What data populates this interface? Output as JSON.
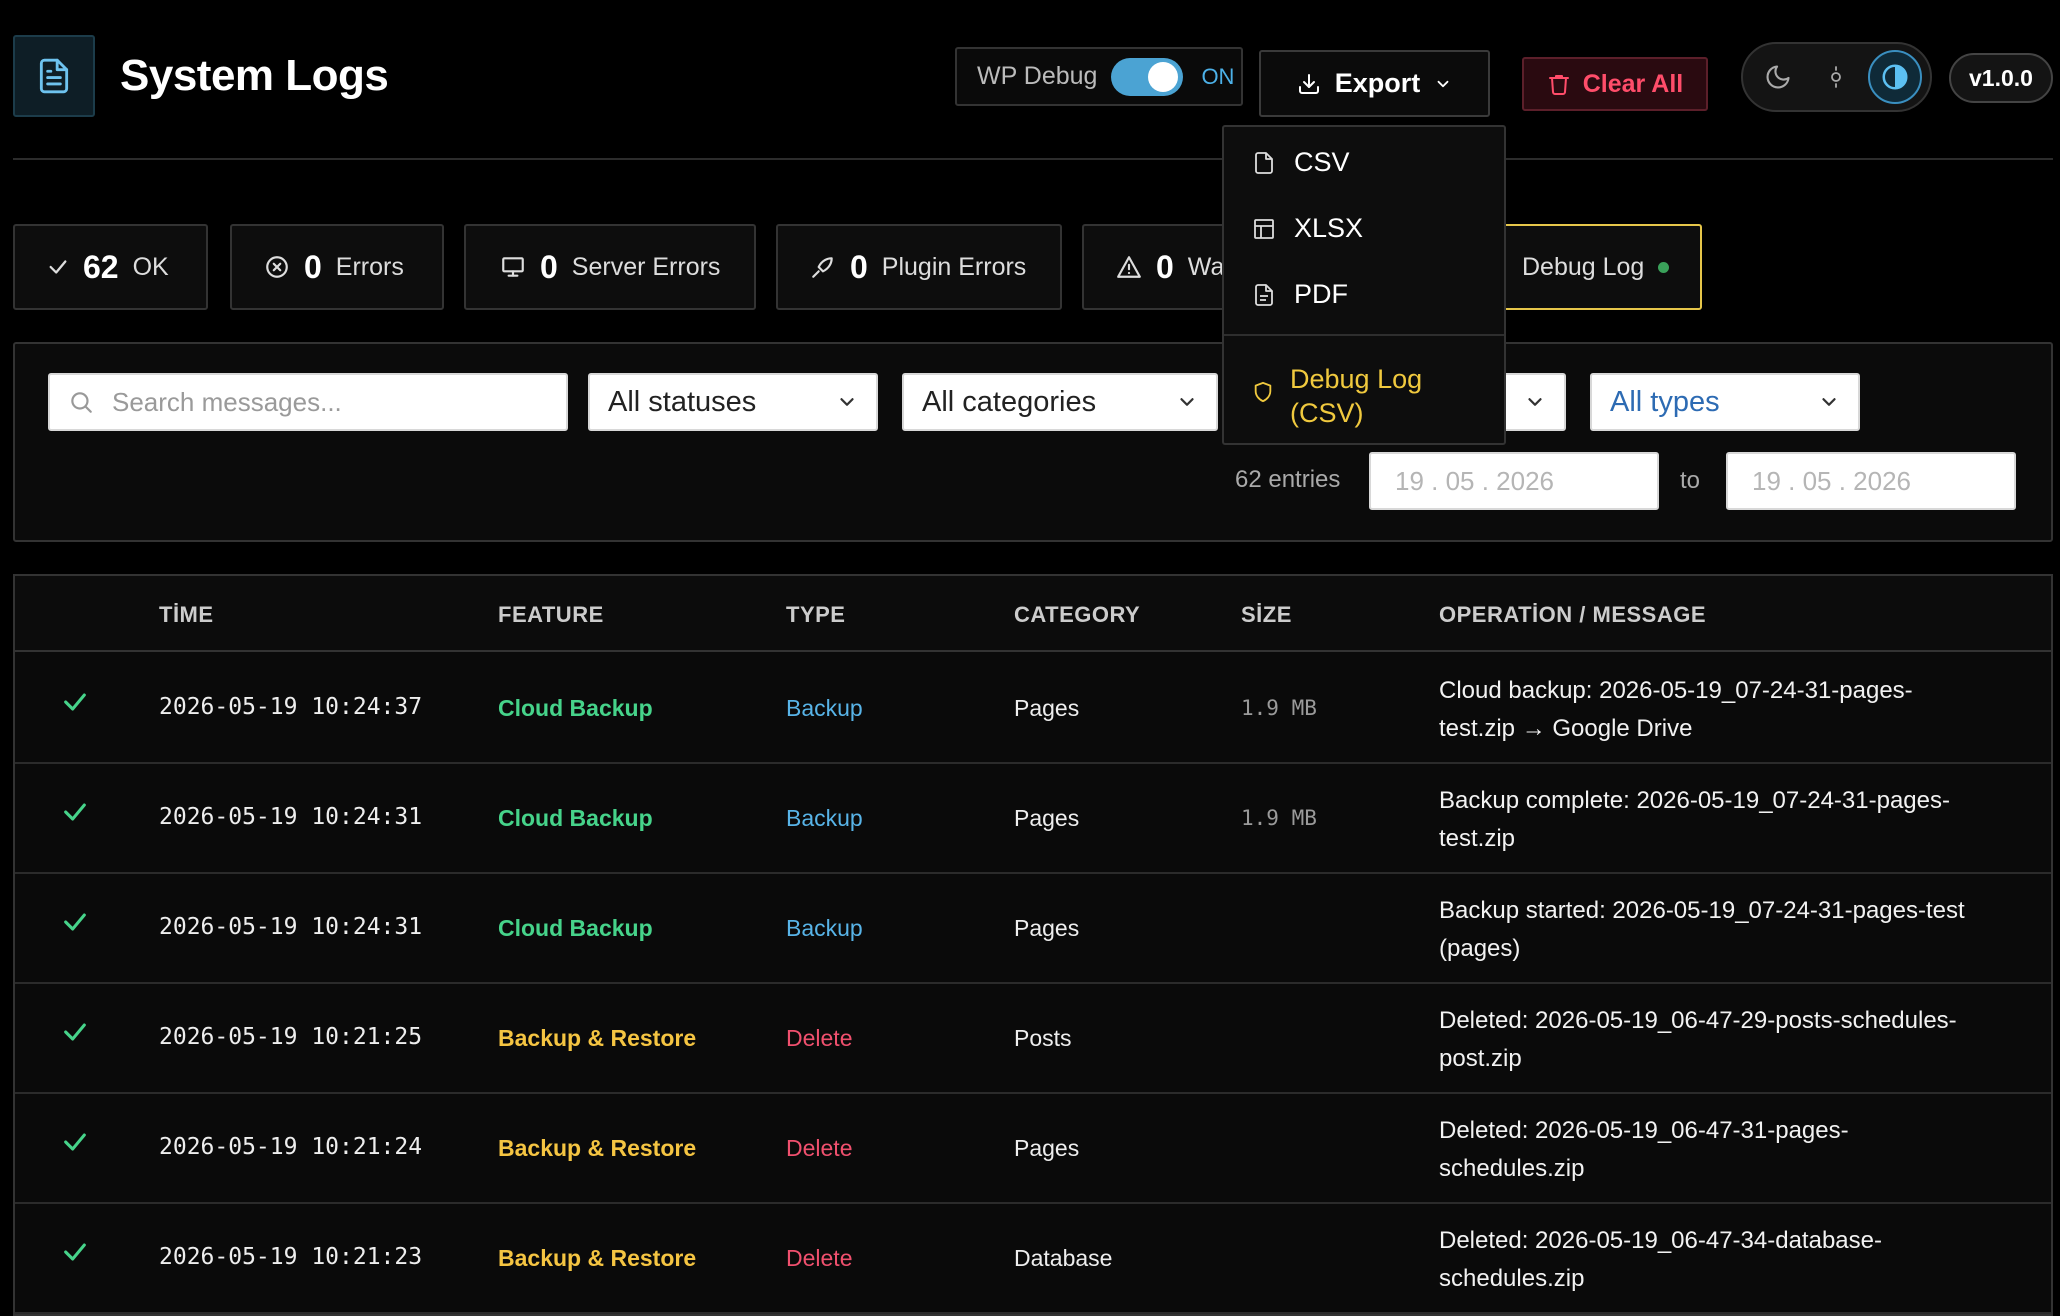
{
  "header": {
    "title": "System Logs",
    "wp_debug_label": "WP Debug",
    "wp_debug_state": "ON",
    "export_label": "Export",
    "clear_label": "Clear All",
    "version": "v1.0.0"
  },
  "stats": [
    {
      "icon": "check-icon",
      "value": "62",
      "label": "OK"
    },
    {
      "icon": "x-circle-icon",
      "value": "0",
      "label": "Errors"
    },
    {
      "icon": "monitor-icon",
      "value": "0",
      "label": "Server Errors"
    },
    {
      "icon": "plug-icon",
      "value": "0",
      "label": "Plugin Errors"
    },
    {
      "icon": "warning-icon",
      "value": "0",
      "label": "Wa"
    }
  ],
  "debug_log_card": {
    "label": "Debug Log",
    "status_color": "#3aa15a"
  },
  "filters": {
    "search_placeholder": "Search messages...",
    "status": "All statuses",
    "category": "All categories",
    "type": "All types",
    "entries": "62 entries",
    "date_from": "19 . 05 . 2026",
    "date_to": "19 . 05 . 2026",
    "to_label": "to"
  },
  "export_menu": {
    "items": [
      {
        "icon": "file-icon",
        "label": "CSV"
      },
      {
        "icon": "table-icon",
        "label": "XLSX"
      },
      {
        "icon": "file-text-icon",
        "label": "PDF"
      }
    ],
    "debug_line1": "Debug Log",
    "debug_line2": "(CSV)"
  },
  "table": {
    "columns": [
      "TİME",
      "FEATURE",
      "TYPE",
      "CATEGORY",
      "SİZE",
      "OPERATİON / MESSAGE"
    ],
    "rows": [
      {
        "time": "2026-05-19 10:24:37",
        "feature": "Cloud Backup",
        "feature_color": "#46d38a",
        "type": "Backup",
        "type_color": "#58b4e8",
        "category": "Pages",
        "size": "1.9 MB",
        "msg1": "Cloud backup: 2026-05-19_07-24-31-pages-",
        "msg2": "test.zip → Google Drive"
      },
      {
        "time": "2026-05-19 10:24:31",
        "feature": "Cloud Backup",
        "feature_color": "#46d38a",
        "type": "Backup",
        "type_color": "#58b4e8",
        "category": "Pages",
        "size": "1.9 MB",
        "msg1": "Backup complete: 2026-05-19_07-24-31-pages-",
        "msg2": "test.zip"
      },
      {
        "time": "2026-05-19 10:24:31",
        "feature": "Cloud Backup",
        "feature_color": "#46d38a",
        "type": "Backup",
        "type_color": "#58b4e8",
        "category": "Pages",
        "size": "",
        "msg1": "Backup started: 2026-05-19_07-24-31-pages-test",
        "msg2": "(pages)"
      },
      {
        "time": "2026-05-19 10:21:25",
        "feature": "Backup & Restore",
        "feature_color": "#f5c542",
        "type": "Delete",
        "type_color": "#f0506e",
        "category": "Posts",
        "size": "",
        "msg1": "Deleted: 2026-05-19_06-47-29-posts-schedules-",
        "msg2": "post.zip"
      },
      {
        "time": "2026-05-19 10:21:24",
        "feature": "Backup & Restore",
        "feature_color": "#f5c542",
        "type": "Delete",
        "type_color": "#f0506e",
        "category": "Pages",
        "size": "",
        "msg1": "Deleted: 2026-05-19_06-47-31-pages-",
        "msg2": "schedules.zip"
      },
      {
        "time": "2026-05-19 10:21:23",
        "feature": "Backup & Restore",
        "feature_color": "#f5c542",
        "type": "Delete",
        "type_color": "#f0506e",
        "category": "Database",
        "size": "",
        "msg1": "Deleted: 2026-05-19_06-47-34-database-",
        "msg2": "schedules.zip"
      }
    ]
  }
}
